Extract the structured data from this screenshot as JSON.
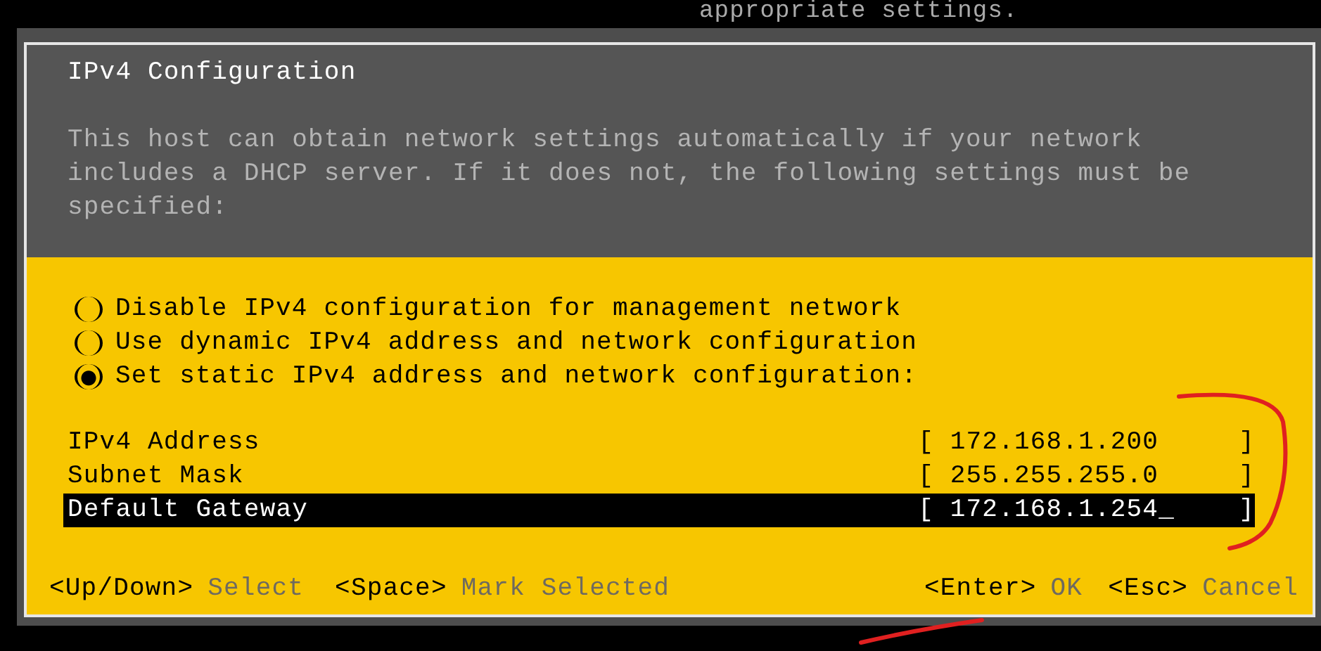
{
  "background_text": "appropriate settings.",
  "dialog": {
    "title": "IPv4 Configuration",
    "description": "This host can obtain network settings automatically if your network includes a DHCP server. If it does not, the following settings must be specified:",
    "options": [
      {
        "label": "Disable IPv4 configuration for management network",
        "selected": false
      },
      {
        "label": "Use dynamic IPv4 address and network configuration",
        "selected": false
      },
      {
        "label": "Set static IPv4 address and network configuration:",
        "selected": true
      }
    ],
    "fields": [
      {
        "label": "IPv4 Address",
        "value": "[ 172.168.1.200     ]",
        "selected": false
      },
      {
        "label": "Subnet Mask",
        "value": "[ 255.255.255.0     ]",
        "selected": false
      },
      {
        "label": "Default Gateway",
        "value": "[ 172.168.1.254_    ]",
        "selected": true
      }
    ],
    "footer_left": [
      {
        "key": "<Up/Down>",
        "action": "Select"
      },
      {
        "key": "<Space>",
        "action": "Mark Selected"
      }
    ],
    "footer_right": [
      {
        "key": "<Enter>",
        "action": "OK"
      },
      {
        "key": "<Esc>",
        "action": "Cancel"
      }
    ]
  }
}
